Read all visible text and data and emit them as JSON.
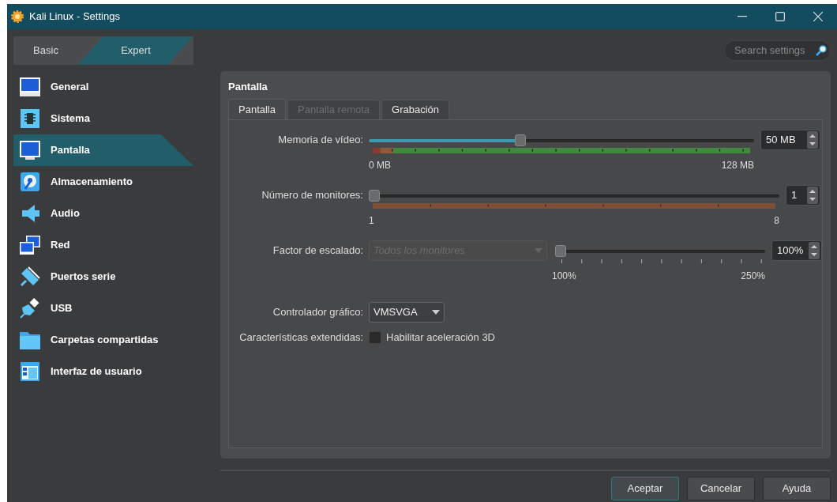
{
  "window": {
    "title": "Kali Linux - Settings"
  },
  "mode_switch": [
    {
      "label": "Basic",
      "selected": false
    },
    {
      "label": "Expert",
      "selected": true
    }
  ],
  "search": {
    "placeholder": "Search settings"
  },
  "sidebar": {
    "items": [
      {
        "label": "General",
        "selected": false
      },
      {
        "label": "Sistema",
        "selected": false
      },
      {
        "label": "Pantalla",
        "selected": true
      },
      {
        "label": "Almacenamiento",
        "selected": false
      },
      {
        "label": "Audio",
        "selected": false
      },
      {
        "label": "Red",
        "selected": false
      },
      {
        "label": "Puertos serie",
        "selected": false
      },
      {
        "label": "USB",
        "selected": false
      },
      {
        "label": "Carpetas compartidas",
        "selected": false
      },
      {
        "label": "Interfaz de usuario",
        "selected": false
      }
    ]
  },
  "panel": {
    "title": "Pantalla",
    "tabs": [
      {
        "label": "Pantalla",
        "selected": true,
        "disabled": false
      },
      {
        "label": "Pantalla remota",
        "selected": false,
        "disabled": true
      },
      {
        "label": "Grabación",
        "selected": false,
        "disabled": false
      }
    ],
    "fields": [
      {
        "kind": "memory",
        "label": "Memoria de vídeo:",
        "level": 0.39,
        "value": "50 MB",
        "min_label": "0 MB",
        "max_label": "128 MB"
      },
      {
        "kind": "monitors",
        "label": "Número de monitores:",
        "level": 0,
        "value": "1",
        "min_label": "1",
        "max_label": "8"
      },
      {
        "kind": "scaling",
        "label": "Factor de escalado:",
        "placeholder": "Todos los monitores",
        "disabled": true,
        "level": 0,
        "value": "100%",
        "min_label": "100%",
        "max_label": "250%"
      },
      {
        "kind": "combo",
        "label": "Controlador gráfico:",
        "value": "VMSVGA"
      },
      {
        "kind": "checkbox",
        "label": "Características extendidas:",
        "option": "Habilitar aceleración 3D",
        "checked": false
      }
    ]
  },
  "buttons": [
    {
      "label": "Aceptar",
      "default": true
    },
    {
      "label": "Cancelar",
      "default": false
    },
    {
      "label": "Ayuda",
      "default": false
    }
  ]
}
